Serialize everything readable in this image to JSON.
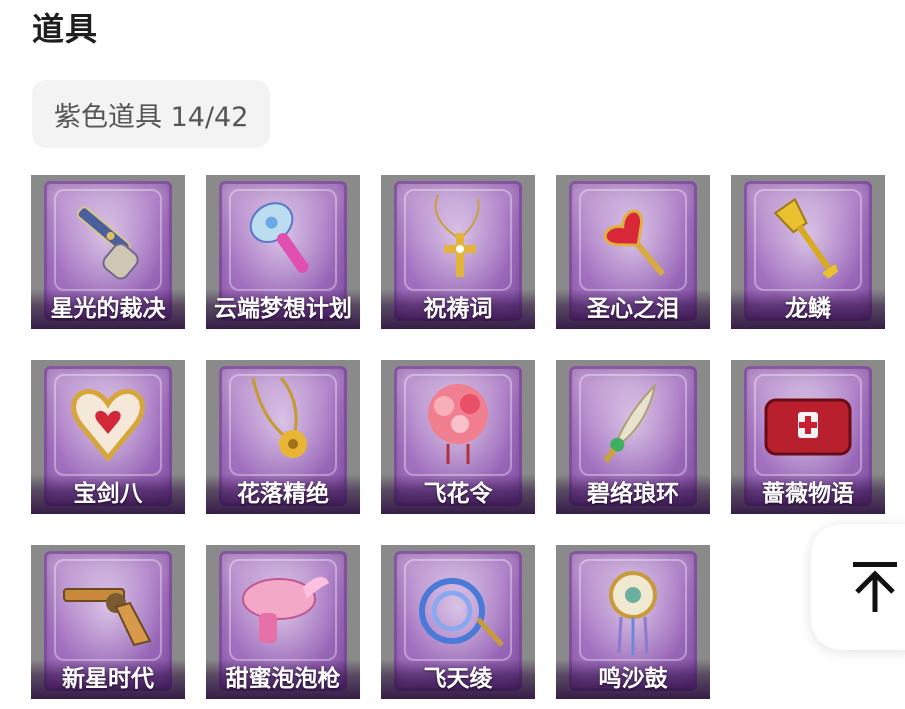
{
  "page": {
    "title": "道具"
  },
  "category": {
    "label": "紫色道具 14/42"
  },
  "items": [
    {
      "name": "星光的裁决",
      "icon": "flintlock-pistol-icon"
    },
    {
      "name": "云端梦想计划",
      "icon": "ice-cream-scepter-icon"
    },
    {
      "name": "祝祷词",
      "icon": "golden-cross-necklace-icon"
    },
    {
      "name": "圣心之泪",
      "icon": "ruby-heart-scepter-icon"
    },
    {
      "name": "龙鳞",
      "icon": "golden-shovel-icon"
    },
    {
      "name": "宝剑八",
      "icon": "heart-emblem-icon"
    },
    {
      "name": "花落精绝",
      "icon": "flower-pendant-icon"
    },
    {
      "name": "飞花令",
      "icon": "flower-bouquet-icon"
    },
    {
      "name": "碧络琅环",
      "icon": "jade-blade-icon"
    },
    {
      "name": "蔷薇物语",
      "icon": "medical-kit-icon"
    },
    {
      "name": "新星时代",
      "icon": "revolver-icon"
    },
    {
      "name": "甜蜜泡泡枪",
      "icon": "bubble-gun-icon"
    },
    {
      "name": "飞天绫",
      "icon": "ribbon-whip-icon"
    },
    {
      "name": "鸣沙鼓",
      "icon": "dreamcatcher-drum-icon"
    }
  ],
  "back_to_top": {
    "icon": "arrow-up-to-top-icon"
  }
}
